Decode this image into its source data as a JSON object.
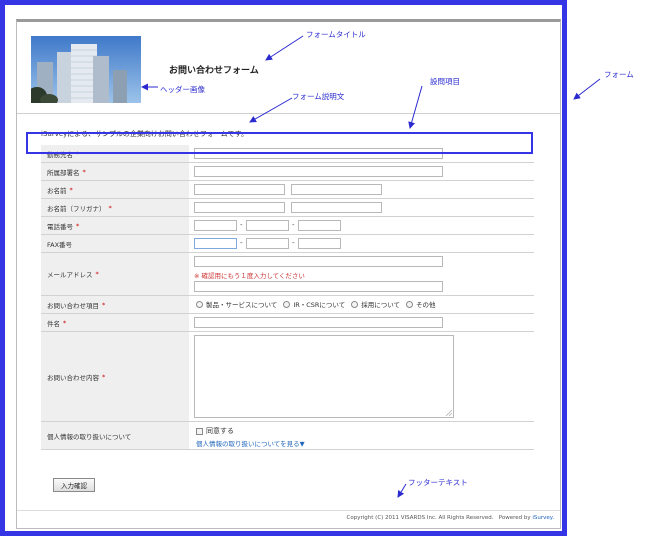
{
  "form": {
    "title": "お問い合わせフォーム",
    "description": "iSurveyによる、サンプルの企業向けお問い合わせフォームです。",
    "required_mark": "*",
    "fields": [
      {
        "label": "勤務先名"
      },
      {
        "label": "所属部署名"
      },
      {
        "label": "お名前"
      },
      {
        "label": "お名前（フリガナ）"
      },
      {
        "label": "電話番号"
      },
      {
        "label": "FAX番号"
      },
      {
        "label": "メールアドレス",
        "hint": "※ 確認用にもう１度入力してください"
      },
      {
        "label": "お問い合わせ項目",
        "options": [
          "製品・サービスについて",
          "IR・CSRについて",
          "採用について",
          "その他"
        ]
      },
      {
        "label": "件名"
      },
      {
        "label": "お問い合わせ内容"
      },
      {
        "label": "個人情報の取り扱いについて",
        "checkbox_label": "同意する",
        "link_text": "個人情報の取り扱いについてを見る▼"
      }
    ],
    "separator": "-",
    "submit_label": "入力確認",
    "footer": {
      "copyright": "Copyright (C) 2011 VISARDS Inc. All Rights Reserved.",
      "powered_by": "Powered by",
      "brand": "iSurvey."
    }
  },
  "annotations": {
    "form_title": "フォームタイトル",
    "header_image": "ヘッダー画像",
    "form_description": "フォーム説明文",
    "question_item": "設問項目",
    "form": "フォーム",
    "footer_text": "フッターテキスト"
  },
  "colors": {
    "frame": "#3535e6",
    "required": "#cc0000",
    "link": "#2266bb",
    "label_bg": "#efefef"
  }
}
